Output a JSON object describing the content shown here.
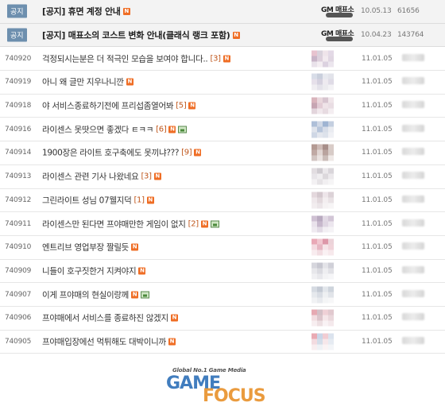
{
  "notices": [
    {
      "tag": "공지",
      "title": "[공지] 휴면 계정 안내",
      "date": "10.05.13",
      "views": "61656"
    },
    {
      "tag": "공지",
      "title": "[공지] 매표소의 코스트 변화 안내(클래식 랭크 포함)",
      "date": "10.04.23",
      "views": "143764"
    }
  ],
  "gm_label": "GM 매표소",
  "posts": [
    {
      "num": "740920",
      "title": "걱정되시는분은 더 적극인 모습을 보여야 합니다..",
      "comments": "[3]",
      "has_image": false,
      "date": "11.01.05",
      "colors": [
        "#e7c3cf",
        "#d9d2dc",
        "#efe4ea",
        "#e3d9e6",
        "#c9b5c8",
        "#ddd0dc",
        "#f2eaef",
        "#e0d6e2",
        "#e9e2ea",
        "#f4eef2",
        "#dcd2e0",
        "#ece6ee"
      ]
    },
    {
      "num": "740919",
      "title": "아니 왜 글만 지우나니깐",
      "comments": "",
      "has_image": false,
      "date": "11.01.05",
      "colors": [
        "#d8dde8",
        "#c9cfdc",
        "#e7e9ef",
        "#e2e3ea",
        "#e6e0ea",
        "#d5d1df",
        "#eeeaf0",
        "#dfdbe6",
        "#f0eef2",
        "#e4e2ea",
        "#ecebef",
        "#f3f2f5"
      ]
    },
    {
      "num": "740918",
      "title": "야 서비스종료하기전에 프리섭좀열어봐",
      "comments": "[5]",
      "has_image": false,
      "date": "11.01.05",
      "colors": [
        "#d9b4bc",
        "#e9d7dc",
        "#d7c4cf",
        "#f0e6ea",
        "#c6a5b2",
        "#e2ccd5",
        "#efe3e8",
        "#e9dde3",
        "#e3d5dc",
        "#f1e8ec",
        "#e7dbe1",
        "#f4eef1"
      ]
    },
    {
      "num": "740916",
      "title": "라이센스 못땃으면 좋겠다 ㅌㅋㅋ",
      "comments": "[6]",
      "has_image": true,
      "date": "11.01.05",
      "colors": [
        "#aebfd8",
        "#d0d8e6",
        "#9fb4d2",
        "#c4cfe0",
        "#e0e4ec",
        "#b7c5db",
        "#d7dde8",
        "#eaecf1",
        "#cfd7e5",
        "#e4e7ee",
        "#dde2eb",
        "#f0f1f5"
      ]
    },
    {
      "num": "740914",
      "title": "1900장은 라이트 호구축에도 못끼냐???",
      "comments": "[9]",
      "has_image": false,
      "date": "11.01.05",
      "colors": [
        "#b49a93",
        "#cdbab5",
        "#a78e89",
        "#d9ccc8",
        "#c0a9a4",
        "#e1d6d3",
        "#b9a39e",
        "#d7cbc7",
        "#d3c6c3",
        "#ebe3e1",
        "#cbbdb9",
        "#efe9e7"
      ]
    },
    {
      "num": "740913",
      "title": "라이센스 관련 기사 나왔네요",
      "comments": "[3]",
      "has_image": false,
      "date": "11.01.05",
      "colors": [
        "#e2dde1",
        "#cfcbd0",
        "#ebe8eb",
        "#d9d5da",
        "#e8e5e9",
        "#f0eef0",
        "#dcd8dc",
        "#ece9ec",
        "#f3f1f3",
        "#e6e3e6",
        "#f1eff1",
        "#f6f5f6"
      ]
    },
    {
      "num": "740912",
      "title": "그린라이트 성님 07웰지덕",
      "comments": "[1]",
      "has_image": false,
      "date": "11.01.05",
      "colors": [
        "#e4d8dd",
        "#d4c8ce",
        "#ede5e9",
        "#dcd2d7",
        "#efe8eb",
        "#e2d8dc",
        "#f3eef0",
        "#e9e2e5",
        "#f2edef",
        "#ebe5e8",
        "#f5f2f3",
        "#f7f5f6"
      ]
    },
    {
      "num": "740911",
      "title": "라이센스만 된다면 프야매만한 게임이 없지",
      "comments": "[2]",
      "has_image": true,
      "date": "11.01.05",
      "colors": [
        "#cfc1d3",
        "#b9aac0",
        "#e1d8e4",
        "#d2c6d6",
        "#e9e2eb",
        "#c7b8cc",
        "#dfd6e2",
        "#ece6ee",
        "#efeaf0",
        "#e2dae5",
        "#f2eff3",
        "#f5f3f6"
      ]
    },
    {
      "num": "740910",
      "title": "엔트리브 영업부장 짤릴듯",
      "comments": "",
      "has_image": false,
      "date": "11.01.05",
      "colors": [
        "#e9a8b6",
        "#f1c7d0",
        "#dd97a8",
        "#ecd3d9",
        "#f4dbe1",
        "#e6b6c2",
        "#f6e4e8",
        "#f0d4da",
        "#f8ecef",
        "#f2dde2",
        "#faf1f3",
        "#f7e9ec"
      ]
    },
    {
      "num": "740909",
      "title": "니들이 호구짓한거 지켜야지",
      "comments": "",
      "has_image": false,
      "date": "11.01.05",
      "colors": [
        "#d6d6dd",
        "#c7c7d0",
        "#e3e3e8",
        "#d0d0d8",
        "#e7e7eb",
        "#dadae0",
        "#eeeef1",
        "#e1e1e6",
        "#f0f0f3",
        "#e8e8ec",
        "#f3f3f5",
        "#f6f6f8"
      ]
    },
    {
      "num": "740907",
      "title": "이게 프야매의 현실이랑께",
      "comments": "",
      "has_image": true,
      "date": "11.01.05",
      "colors": [
        "#d6dbe2",
        "#c4cad4",
        "#e2e6eb",
        "#ced4dc",
        "#e6e9ed",
        "#d9dde4",
        "#eef0f2",
        "#e1e4e9",
        "#f1f2f4",
        "#e8eaee",
        "#f4f5f6",
        "#f7f7f8"
      ]
    },
    {
      "num": "740906",
      "title": "프야매에서 서비스를 종료하진 않겠지",
      "comments": "",
      "has_image": false,
      "date": "11.01.05",
      "colors": [
        "#e6a9b2",
        "#d3c0c7",
        "#efd0d6",
        "#e1c9cf",
        "#f2dde1",
        "#dcc5cb",
        "#f5e6e9",
        "#ead8dc",
        "#f7eef0",
        "#eddfe2",
        "#f9f2f4",
        "#f4e9ec"
      ]
    },
    {
      "num": "740905",
      "title": "프야매입장에선 먹튀해도 대박이니까",
      "comments": "",
      "has_image": false,
      "date": "11.01.05",
      "colors": [
        "#e9aab3",
        "#c9d6e8",
        "#f1cdd3",
        "#dbe3ee",
        "#f3dbe0",
        "#d4dde9",
        "#f6e7ea",
        "#e6ebf2",
        "#f8eef0",
        "#eef1f5",
        "#faf3f4",
        "#f3f5f8"
      ]
    }
  ],
  "watermark": {
    "tagline": "Global No.1 Game Media",
    "word1": "GAME",
    "word2": "FOCUS"
  }
}
